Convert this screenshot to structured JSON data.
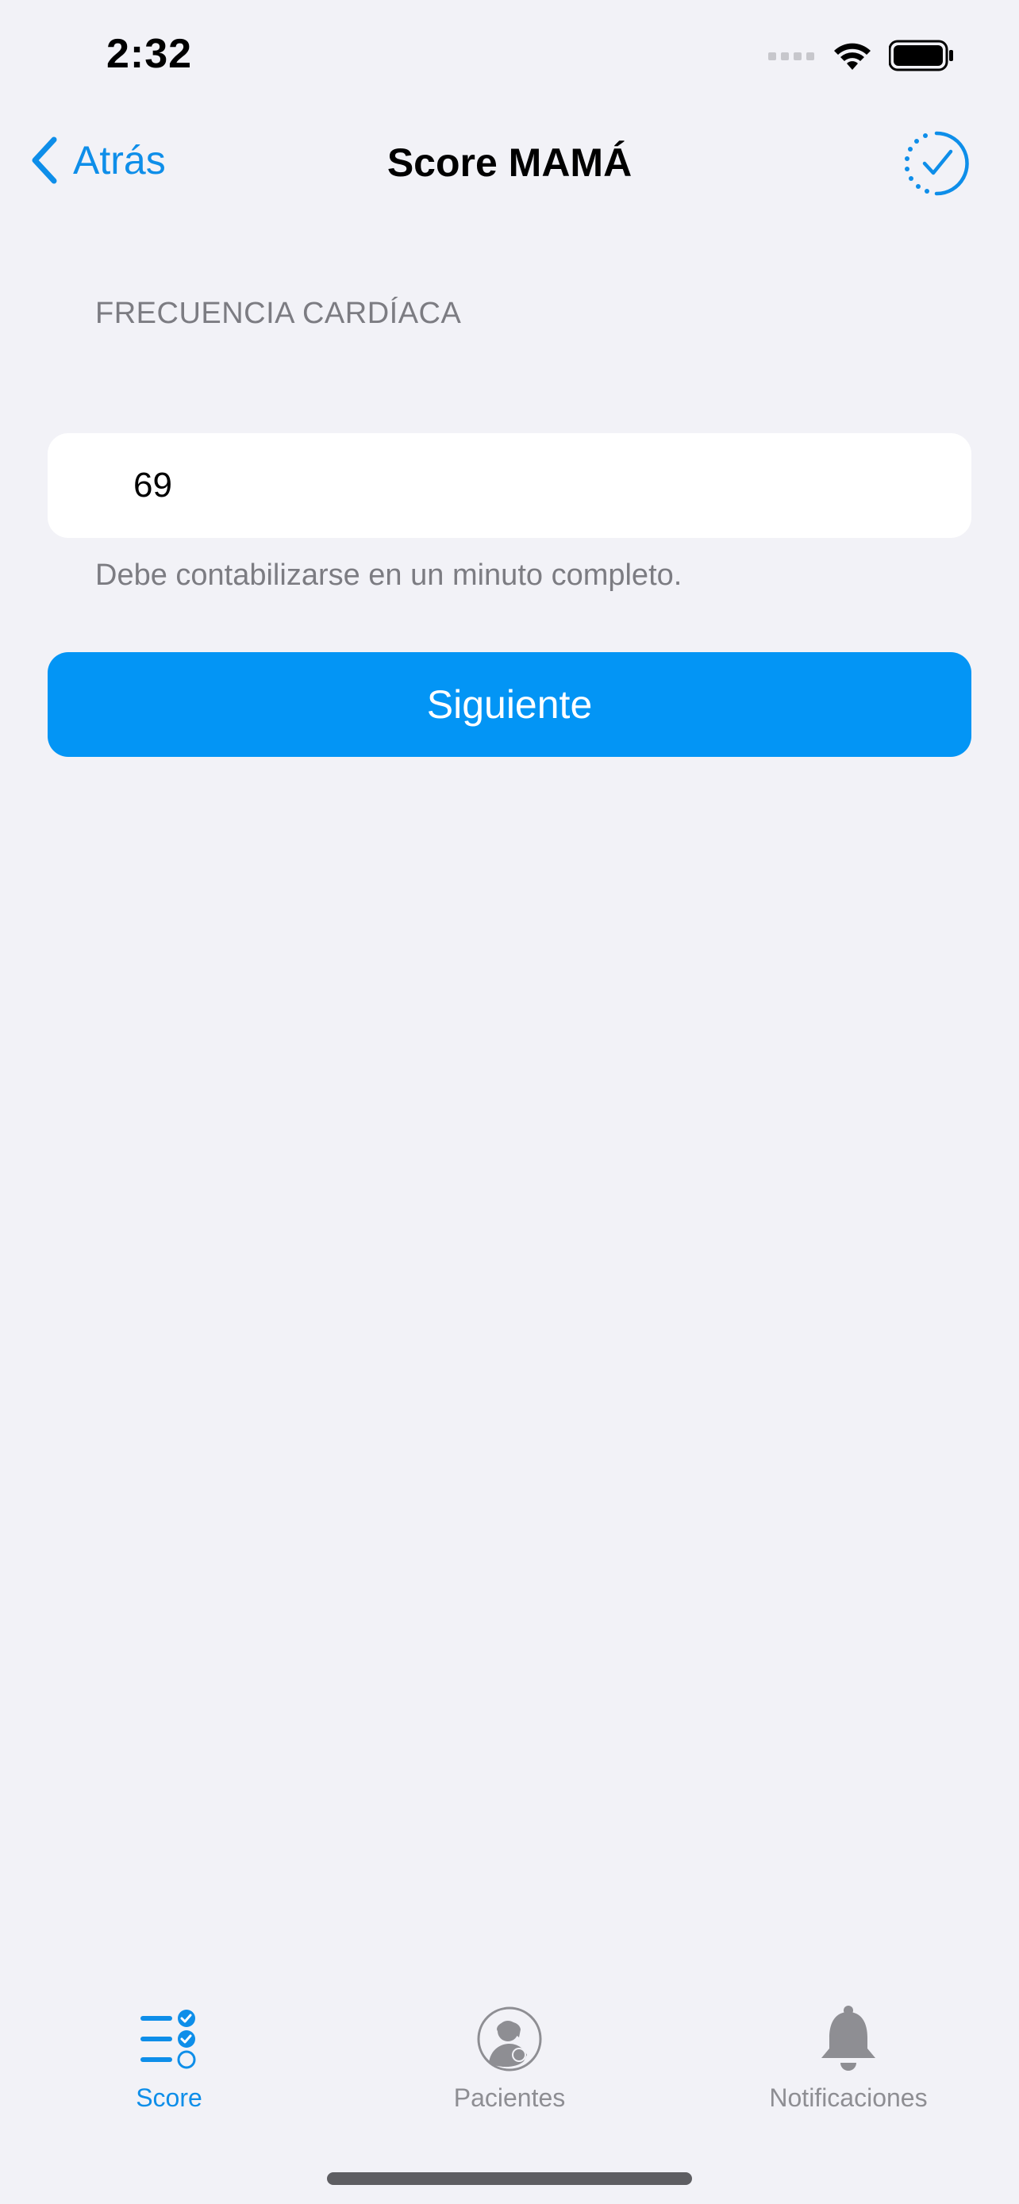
{
  "status_bar": {
    "time": "2:32"
  },
  "nav": {
    "back_label": "Atrás",
    "title": "Score MAMÁ",
    "action_icon": "checkmark-circle-dotted-icon"
  },
  "form": {
    "section_header": "FRECUENCIA CARDÍACA",
    "value": "69",
    "footer": "Debe contabilizarse en un minuto completo.",
    "next_label": "Siguiente"
  },
  "tabs": [
    {
      "label": "Score",
      "icon": "checklist-icon",
      "active": true
    },
    {
      "label": "Pacientes",
      "icon": "patient-avatar-icon",
      "active": false
    },
    {
      "label": "Notificaciones",
      "icon": "bell-icon",
      "active": false
    }
  ],
  "colors": {
    "accent": "#0e8ee9",
    "button": "#0395f5",
    "background": "#f2f2f7",
    "secondary_text": "#7c7c82",
    "inactive_tab": "#8e8e93"
  }
}
